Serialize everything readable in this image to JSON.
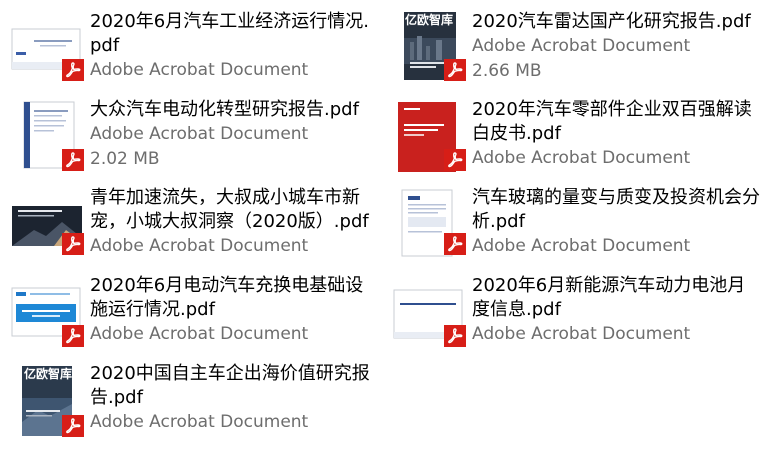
{
  "files": [
    {
      "name": "2020年6月汽车工业经济运行情况.pdf",
      "type": "Adobe Acrobat Document",
      "size": ""
    },
    {
      "name": "2020汽车雷达国产化研究报告.pdf",
      "type": "Adobe Acrobat Document",
      "size": "2.66 MB",
      "cover_text": "亿欧智库"
    },
    {
      "name": "大众汽车电动化转型研究报告.pdf",
      "type": "Adobe Acrobat Document",
      "size": "2.02 MB"
    },
    {
      "name": "2020年汽车零部件企业双百强解读白皮书.pdf",
      "type": "Adobe Acrobat Document",
      "size": ""
    },
    {
      "name": "青年加速流失，大叔成小城车市新宠，小城大叔洞察（2020版）.pdf",
      "type": "Adobe Acrobat Document",
      "size": ""
    },
    {
      "name": "汽车玻璃的量变与质变及投资机会分析.pdf",
      "type": "Adobe Acrobat Document",
      "size": ""
    },
    {
      "name": "2020年6月电动汽车充换电基础设施运行情况.pdf",
      "type": "Adobe Acrobat Document",
      "size": ""
    },
    {
      "name": "2020年6月新能源汽车动力电池月度信息.pdf",
      "type": "Adobe Acrobat Document",
      "size": ""
    },
    {
      "name": "2020中国自主车企出海价值研究报告.pdf",
      "type": "Adobe Acrobat Document",
      "size": "",
      "cover_text": "亿欧智库"
    }
  ],
  "colors": {
    "pdf_red": "#d71e17",
    "meta_gray": "#6d6d6d"
  },
  "icons": {
    "pdf_badge": "adobe-acrobat-icon"
  }
}
